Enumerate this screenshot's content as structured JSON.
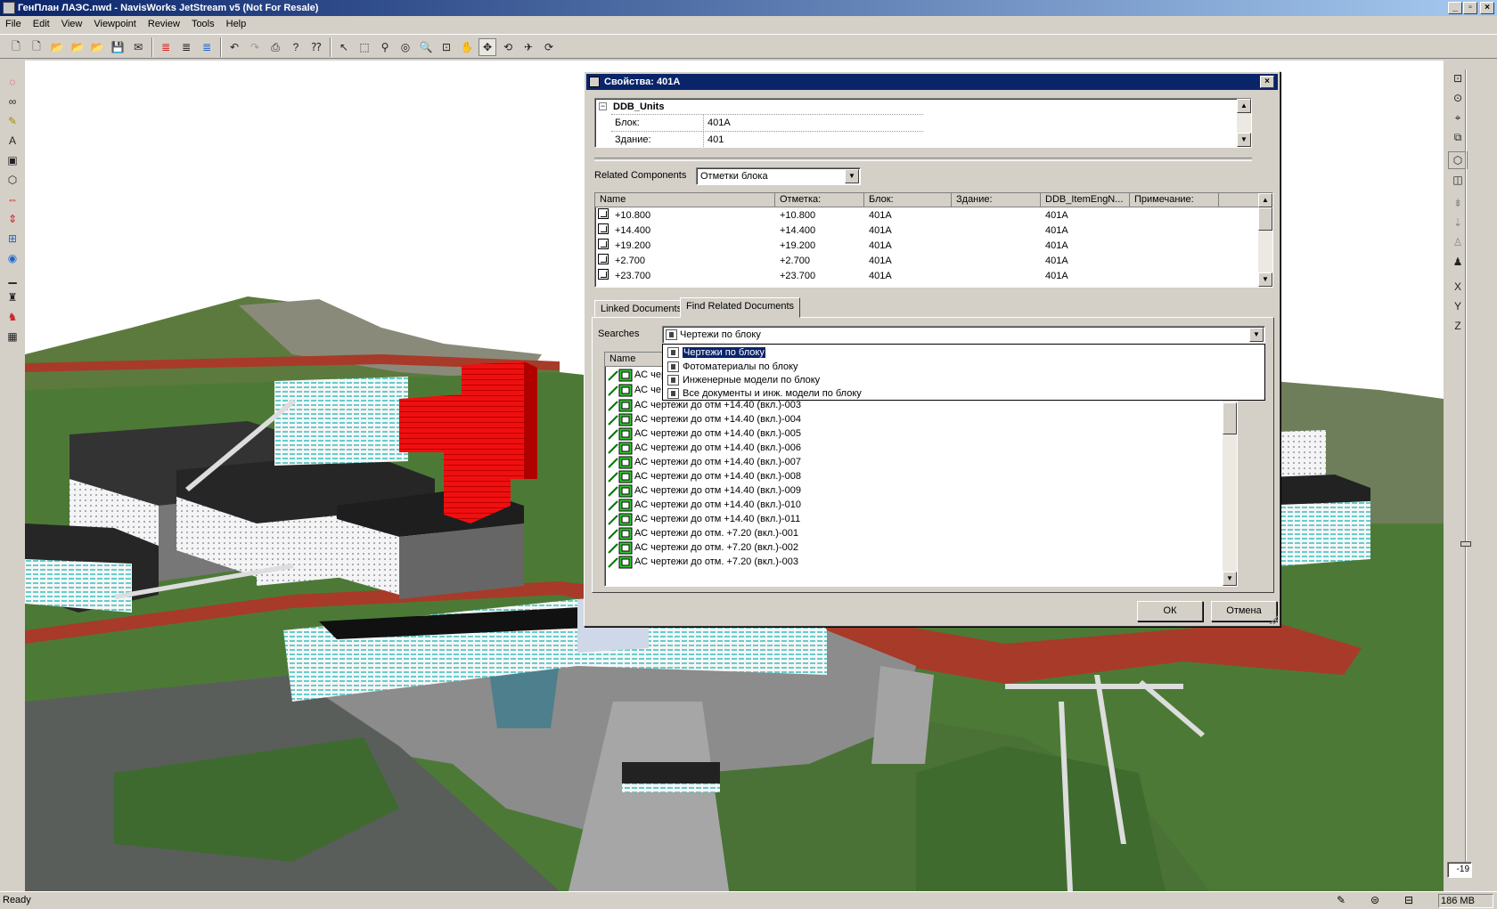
{
  "window": {
    "title": "ГенПлан ЛАЭС.nwd - NavisWorks JetStream v5 (Not For Resale)"
  },
  "menu": [
    "File",
    "Edit",
    "View",
    "Viewpoint",
    "Review",
    "Tools",
    "Help"
  ],
  "dialog": {
    "title": "Свойства: 401А",
    "properties": {
      "group": "DDB_Units",
      "rows": [
        {
          "label": "Блок:",
          "value": "401А"
        },
        {
          "label": "Здание:",
          "value": "401"
        }
      ]
    },
    "related_components": {
      "label": "Related Components",
      "selected": "Отметки блока",
      "columns": [
        "Name",
        "Отметка:",
        "Блок:",
        "Здание:",
        "DDB_ItemEngN...",
        "Примечание:"
      ],
      "rows": [
        {
          "name": "+10.800",
          "mark": "+10.800",
          "block": "401А",
          "building": "",
          "item": "401А",
          "note": ""
        },
        {
          "name": "+14.400",
          "mark": "+14.400",
          "block": "401А",
          "building": "",
          "item": "401А",
          "note": ""
        },
        {
          "name": "+19.200",
          "mark": "+19.200",
          "block": "401А",
          "building": "",
          "item": "401А",
          "note": ""
        },
        {
          "name": "+2.700",
          "mark": "+2.700",
          "block": "401А",
          "building": "",
          "item": "401А",
          "note": ""
        },
        {
          "name": "+23.700",
          "mark": "+23.700",
          "block": "401А",
          "building": "",
          "item": "401А",
          "note": ""
        }
      ]
    },
    "tabs": [
      "Linked Documents",
      "Find Related Documents"
    ],
    "searches": {
      "label": "Searches",
      "selected": "Чертежи по блоку",
      "options": [
        "Чертежи по блоку",
        "Фотоматериалы по блоку",
        "Инженерные модели по блоку",
        "Все документы и инж. модели по блоку"
      ]
    },
    "documents": {
      "column": "Name",
      "partial_rows": [
        "АС чер",
        "АС че"
      ],
      "rows": [
        "АС чертежи до отм +14.40 (вкл.)-003",
        "АС чертежи до отм +14.40 (вкл.)-004",
        "АС чертежи до отм +14.40 (вкл.)-005",
        "АС чертежи до отм +14.40 (вкл.)-006",
        "АС чертежи до отм +14.40 (вкл.)-007",
        "АС чертежи до отм +14.40 (вкл.)-008",
        "АС чертежи до отм +14.40 (вкл.)-009",
        "АС чертежи до отм +14.40 (вкл.)-010",
        "АС чертежи до отм +14.40 (вкл.)-011",
        "АС чертежи до отм. +7.20 (вкл.)-001",
        "АС чертежи до отм. +7.20 (вкл.)-002",
        "АС чертежи до отм. +7.20 (вкл.)-003"
      ]
    },
    "ok": "ОК",
    "cancel": "Отмена"
  },
  "status": {
    "text": "Ready",
    "memory": "186 MB"
  },
  "right_bar": {
    "axes": [
      "X",
      "Y",
      "Z"
    ],
    "readout": "-19"
  },
  "colors": {
    "title_active": "#0a246a",
    "highlight_building": "#ee0000",
    "grass": "#4a7a3a",
    "road_red": "#a83a2a"
  }
}
